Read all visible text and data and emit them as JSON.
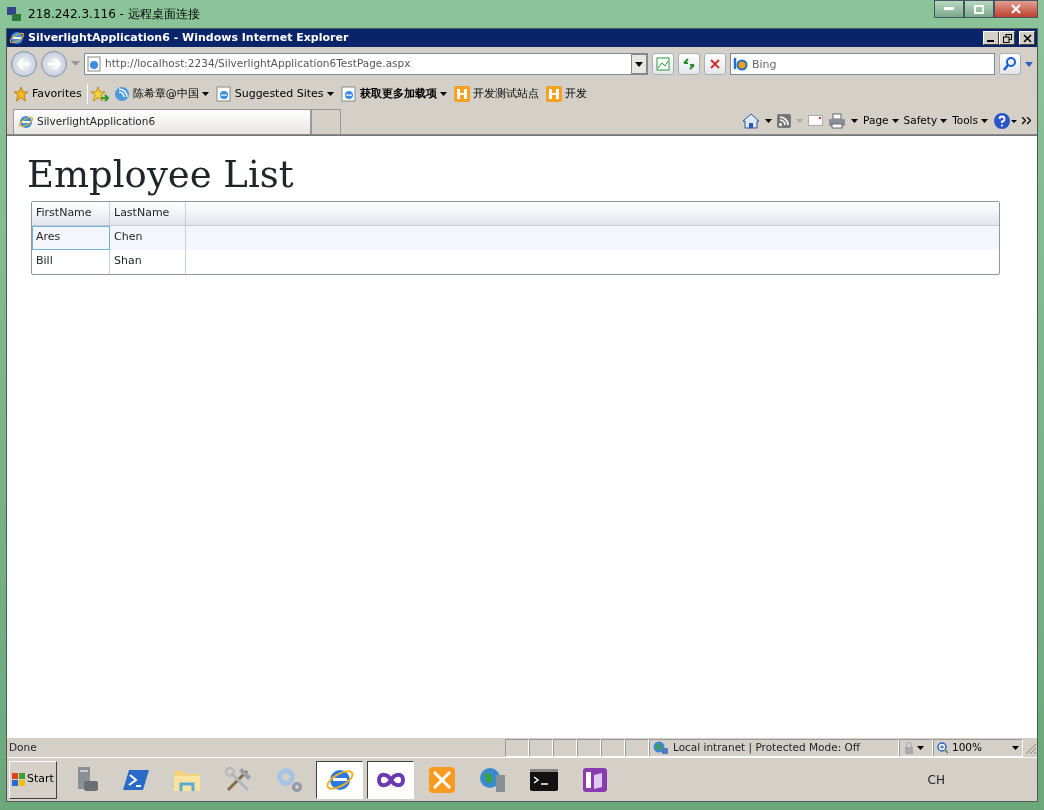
{
  "rdp_window": {
    "title": "218.242.3.116 - 远程桌面连接"
  },
  "ie_window": {
    "title": "SilverlightApplication6 - Windows Internet Explorer"
  },
  "address_bar": {
    "url": "http://localhost:2234/SilverlightApplication6TestPage.aspx"
  },
  "search": {
    "placeholder": "Bing"
  },
  "favorites_bar": {
    "favorites_label": "Favorites",
    "links": [
      {
        "label": "陈希章@中国",
        "kind": "feed",
        "dropdown": true,
        "bold": false
      },
      {
        "label": "Suggested Sites",
        "kind": "ie",
        "dropdown": true,
        "bold": false
      },
      {
        "label": "获取更多加载项",
        "kind": "ie",
        "dropdown": true,
        "bold": true
      },
      {
        "label": "开发测试站点",
        "kind": "app",
        "dropdown": false,
        "bold": false
      },
      {
        "label": "开发",
        "kind": "app",
        "dropdown": false,
        "bold": false
      }
    ]
  },
  "tabs": [
    {
      "label": "SilverlightApplication6",
      "selected": true
    }
  ],
  "command_bar": [
    "Page",
    "Safety",
    "Tools"
  ],
  "page": {
    "title": "Employee List",
    "grid": {
      "columns": [
        "FirstName",
        "LastName"
      ],
      "rows": [
        {
          "cells": [
            "Ares",
            "Chen"
          ],
          "selected": true
        },
        {
          "cells": [
            "Bill",
            "Shan"
          ],
          "selected": false
        }
      ]
    }
  },
  "status_bar": {
    "text": "Done",
    "zone": "Local intranet | Protected Mode: Off",
    "zoom": "100%"
  },
  "taskbar": {
    "start": "Start",
    "apps": [
      {
        "kind": "server",
        "active": false
      },
      {
        "kind": "powershell",
        "active": false
      },
      {
        "kind": "folder",
        "active": false
      },
      {
        "kind": "tools",
        "active": false
      },
      {
        "kind": "gears",
        "active": false
      },
      {
        "kind": "ie",
        "active": true
      },
      {
        "kind": "infinity",
        "active": true
      },
      {
        "kind": "wrench",
        "active": false
      },
      {
        "kind": "globe",
        "active": false
      },
      {
        "kind": "console",
        "active": false
      },
      {
        "kind": "onenote",
        "active": false
      }
    ],
    "language": "CH"
  }
}
